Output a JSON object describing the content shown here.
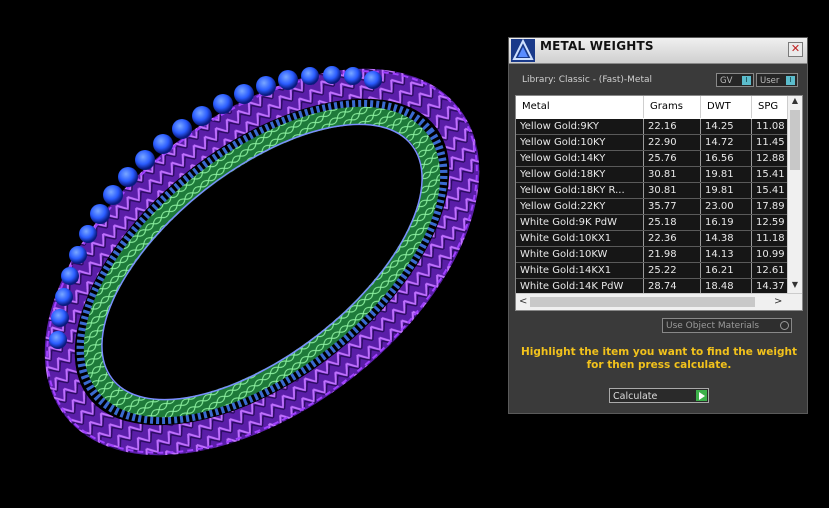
{
  "panel": {
    "title": "METAL WEIGHTS",
    "close_glyph": "✕",
    "library": "Library: Classic - (Fast)-Metal",
    "gv_label": "GV",
    "user_label": "User",
    "toggle_mark": "I",
    "columns": [
      "Metal",
      "Grams",
      "DWT",
      "SPG"
    ],
    "rows": [
      [
        "Yellow Gold:9KY",
        "22.16",
        "14.25",
        "11.08"
      ],
      [
        "Yellow Gold:10KY",
        "22.90",
        "14.72",
        "11.45"
      ],
      [
        "Yellow Gold:14KY",
        "25.76",
        "16.56",
        "12.88"
      ],
      [
        "Yellow Gold:18KY",
        "30.81",
        "19.81",
        "15.41"
      ],
      [
        "Yellow Gold:18KY R...",
        "30.81",
        "19.81",
        "15.41"
      ],
      [
        "Yellow Gold:22KY",
        "35.77",
        "23.00",
        "17.89"
      ],
      [
        "White Gold:9K PdW",
        "25.18",
        "16.19",
        "12.59"
      ],
      [
        "White Gold:10KX1",
        "22.36",
        "14.38",
        "11.18"
      ],
      [
        "White Gold:10KW",
        "21.98",
        "14.13",
        "10.99"
      ],
      [
        "White Gold:14KX1",
        "25.22",
        "16.21",
        "12.61"
      ],
      [
        "White Gold:14K PdW",
        "28.74",
        "18.48",
        "14.37"
      ]
    ],
    "use_object_materials": "Use Object Materials",
    "hint": "Highlight the item you want to find the weight for then press calculate.",
    "calculate_label": "Calculate",
    "scroll_up": "▲",
    "scroll_down": "▼",
    "scroll_left": "<",
    "scroll_right": ">"
  },
  "icons": {
    "app": "jewelry-cad-logo-icon",
    "close": "close-icon",
    "calculate": "play-arrow-icon"
  },
  "colors": {
    "hint": "#f2c21c",
    "ring_outer": "#7a2dd0",
    "ring_inner": "#2fb04a",
    "gem": "#2a5cff",
    "toggle_indicator": "#5bbccc"
  }
}
